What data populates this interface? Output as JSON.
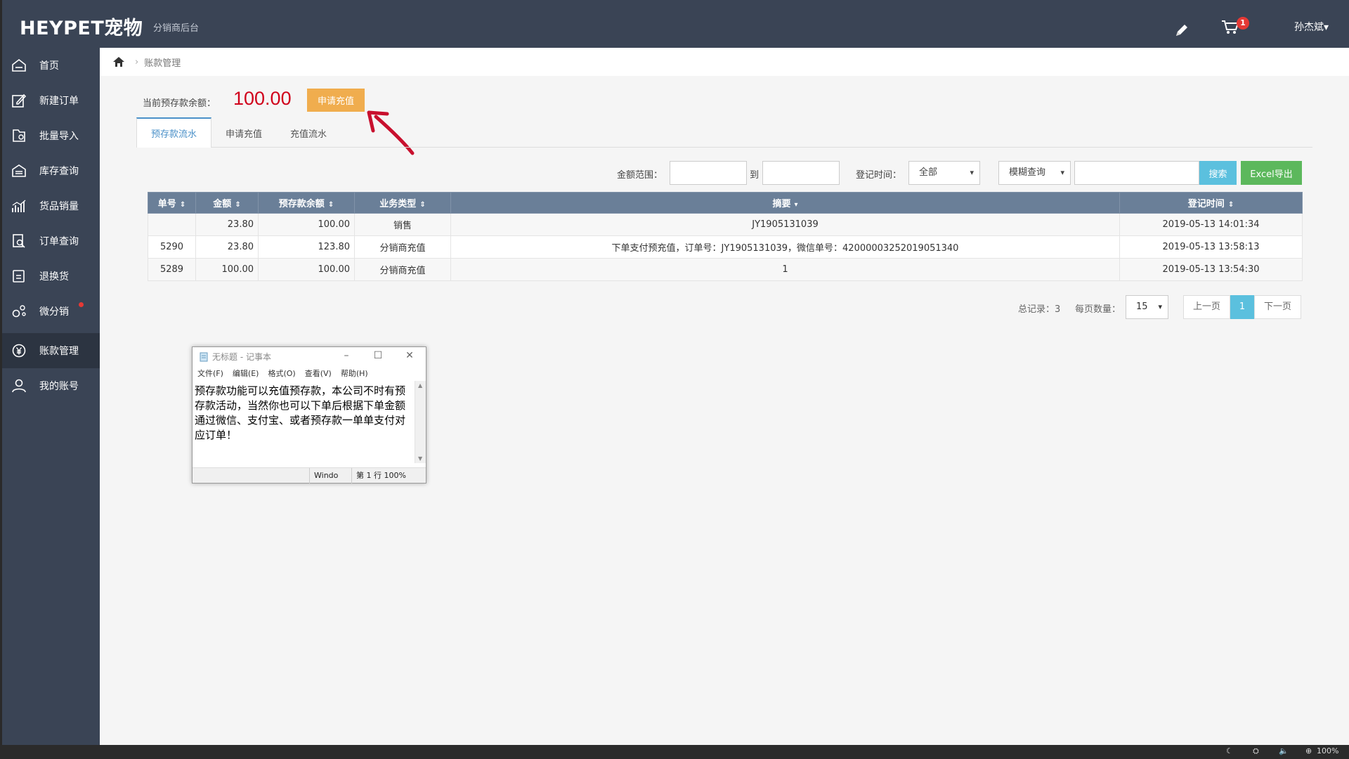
{
  "header": {
    "logo": "HEYPET宠物",
    "subtitle": "分销商后台",
    "cart_badge": "1",
    "user": "孙杰斌▾"
  },
  "sidebar": {
    "items": [
      {
        "label": "首页",
        "icon": "home-icon"
      },
      {
        "label": "新建订单",
        "icon": "edit-icon"
      },
      {
        "label": "批量导入",
        "icon": "import-icon"
      },
      {
        "label": "库存查询",
        "icon": "warehouse-icon"
      },
      {
        "label": "货品销量",
        "icon": "chart-icon"
      },
      {
        "label": "订单查询",
        "icon": "search-doc-icon"
      },
      {
        "label": "退换货",
        "icon": "return-icon"
      },
      {
        "label": "微分销",
        "icon": "share-icon"
      },
      {
        "label": "账款管理",
        "icon": "yen-icon"
      },
      {
        "label": "我的账号",
        "icon": "user-icon"
      }
    ],
    "active": "账款管理"
  },
  "breadcrumb": {
    "current": "账款管理"
  },
  "balance": {
    "label": "当前预存款余额：",
    "value": "100.00",
    "recharge_label": "申请充值"
  },
  "tabs": [
    "预存款流水",
    "申请充值",
    "充值流水"
  ],
  "filters": {
    "amount_label": "金额范围：",
    "to_label": "到",
    "time_label": "登记时间：",
    "time_value": "全部",
    "mode_value": "模糊查询",
    "search_label": "搜索",
    "excel_label": "Excel导出"
  },
  "table": {
    "columns": [
      "单号",
      "金额",
      "预存款余额",
      "业务类型",
      "摘要",
      "登记时间"
    ],
    "rows": [
      {
        "id": "",
        "amount": "23.80",
        "balance": "100.00",
        "type": "销售",
        "summary": "JY1905131039",
        "time": "2019-05-13 14:01:34"
      },
      {
        "id": "5290",
        "amount": "23.80",
        "balance": "123.80",
        "type": "分销商充值",
        "summary": "下单支付预充值，订单号：JY1905131039，微信单号：4200000325201905134​0",
        "time": "2019-05-13 13:58:13"
      },
      {
        "id": "5289",
        "amount": "100.00",
        "balance": "100.00",
        "type": "分销商充值",
        "summary": "1",
        "time": "2019-05-13 13:54:30"
      }
    ]
  },
  "pager": {
    "total_label": "总记录：3",
    "per_page_label": "每页数量：",
    "per_page": "15",
    "prev": "上一页",
    "current": "1",
    "next": "下一页"
  },
  "notepad": {
    "title": "无标题 - 记事本",
    "menu": [
      "文件(F)",
      "编辑(E)",
      "格式(O)",
      "查看(V)",
      "帮助(H)"
    ],
    "content": "预存款功能可以充值预存款，本公司不时有预存款活动，当然你也可以下单后根据下单金额通过微信、支付宝、或者预存款一单单支付对应订单！",
    "status_encoding": "Windo",
    "status_pos": "第 1 行 100%"
  },
  "taskbar": {
    "zoom": "100%"
  },
  "colors": {
    "header_bg": "#3a4455",
    "accent_blue": "#5bc0de",
    "accent_green": "#5cb85c",
    "accent_orange": "#f0ad4e",
    "balance_red": "#d0021b",
    "table_header": "#6a7f98"
  }
}
